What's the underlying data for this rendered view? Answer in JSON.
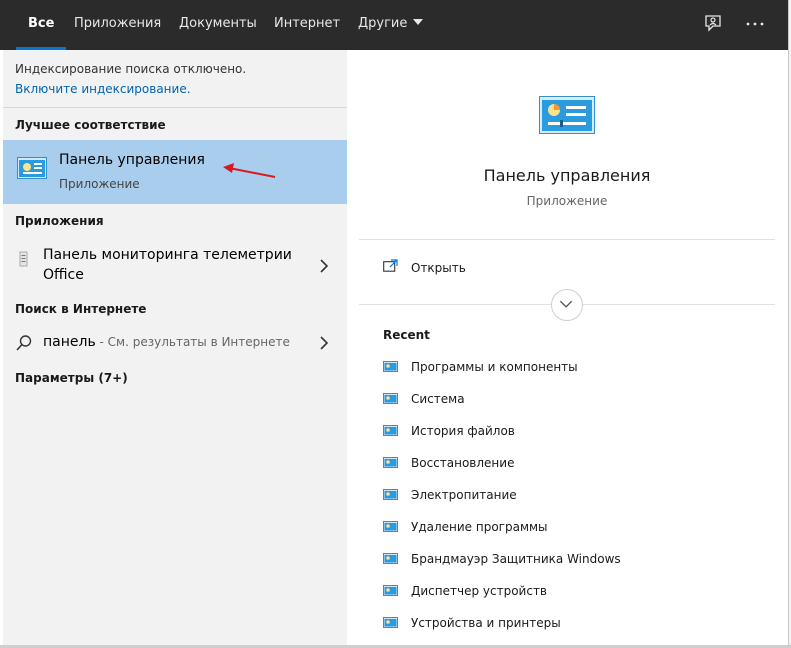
{
  "tabs": {
    "all": "Все",
    "apps": "Приложения",
    "docs": "Документы",
    "web": "Интернет",
    "more": "Другие"
  },
  "top_icons": {
    "feedback": "feedback-icon",
    "more": "more-options-icon"
  },
  "left": {
    "notice": "Индексирование поиска отключено.",
    "notice_link": "Включите индексирование.",
    "best_match_header": "Лучшее соответствие",
    "best_match": {
      "title": "Панель управления",
      "subtitle": "Приложение"
    },
    "apps_header": "Приложения",
    "app_item": "Панель мониторинга телеметрии Office",
    "web_header": "Поиск в Интернете",
    "web_query": "панель",
    "web_hint": " - См. результаты в Интернете",
    "settings_header": "Параметры (7+)"
  },
  "right": {
    "title": "Панель управления",
    "subtitle": "Приложение",
    "open_label": "Открыть",
    "recent_header": "Recent",
    "recent_items": [
      "Программы и компоненты",
      "Система",
      "История файлов",
      "Восстановление",
      "Электропитание",
      "Удаление программы",
      "Брандмауэр Защитника Windows",
      "Диспетчер устройств",
      "Устройства и принтеры"
    ]
  },
  "colors": {
    "topbar": "#2b2b2b",
    "accent": "#0078d7",
    "selected": "#a9cdec",
    "link": "#0063b1",
    "annotation_arrow": "#d71921"
  }
}
